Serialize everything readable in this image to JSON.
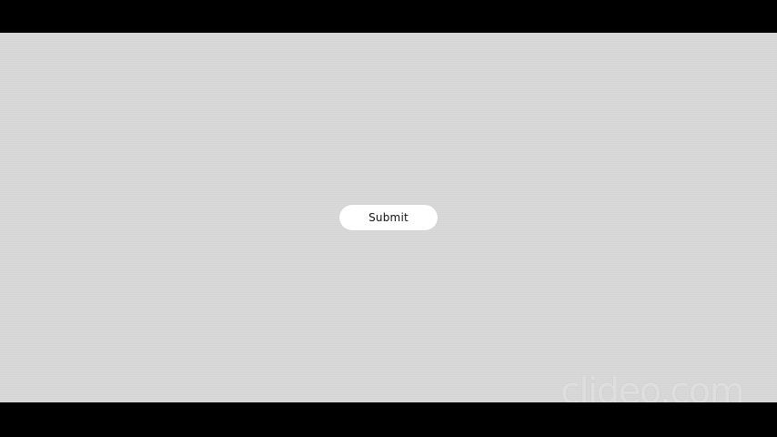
{
  "form": {
    "submit_label": "Submit"
  },
  "watermark": {
    "text": "clideo.com"
  },
  "colors": {
    "background": "#d9d9d9",
    "letterbox": "#000000",
    "button_background": "#ffffff",
    "button_text": "#111111"
  }
}
